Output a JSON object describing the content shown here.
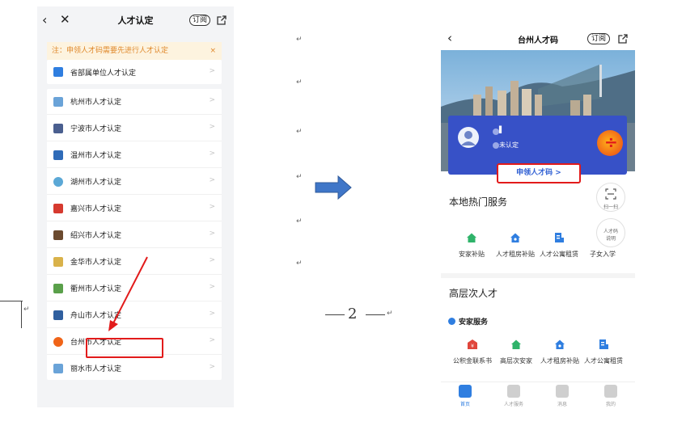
{
  "left_phone": {
    "title": "人才认定",
    "back_glyph": "‹",
    "close_glyph": "✕",
    "subscribe": "订阅",
    "notice": "注：申领人才码需要先进行人才认定",
    "notice_close": "×",
    "items": [
      {
        "label": "省部属单位人才认定"
      },
      {
        "label": "杭州市人才认定"
      },
      {
        "label": "宁波市人才认定"
      },
      {
        "label": "温州市人才认定"
      },
      {
        "label": "湖州市人才认定"
      },
      {
        "label": "嘉兴市人才认定"
      },
      {
        "label": "绍兴市人才认定"
      },
      {
        "label": "金华市人才认定"
      },
      {
        "label": "衢州市人才认定"
      },
      {
        "label": "舟山市人才认定"
      },
      {
        "label": "台州市人才认定"
      },
      {
        "label": "丽水市人才认定"
      }
    ],
    "chevron": ">"
  },
  "document": {
    "return_mark": "↵",
    "page_number": "2"
  },
  "right_phone": {
    "title": "台州人才码",
    "back_glyph": "‹",
    "subscribe": "订阅",
    "profile": {
      "name_masked": "▌",
      "status": "未认定"
    },
    "apply_button": "申领人才码  >",
    "local_services_title": "本地热门服务",
    "local_services": [
      {
        "label": "安家补贴",
        "icon": "house-icon",
        "color": "#2fb36a"
      },
      {
        "label": "人才租房补贴",
        "icon": "house-icon",
        "color": "#2f7ee0"
      },
      {
        "label": "人才公寓租赁",
        "icon": "apartment-icon",
        "color": "#2f7ee0"
      },
      {
        "label": "子女入学",
        "icon": "student-icon",
        "color": "#2f7ee0"
      }
    ],
    "float_scan": "扫一扫",
    "float_code_line1": "人才码",
    "float_code_line2": "说明",
    "high_level_title": "高层次人才",
    "settle_title": "安家服务",
    "settle_services": [
      {
        "label": "公积金联系书",
        "icon": "fund-icon",
        "color": "#e0463c"
      },
      {
        "label": "高层次安家",
        "icon": "house-icon",
        "color": "#2fb36a"
      },
      {
        "label": "人才租房补贴",
        "icon": "house-icon",
        "color": "#2f7ee0"
      },
      {
        "label": "人才公寓租赁",
        "icon": "apartment-icon",
        "color": "#2f7ee0"
      }
    ],
    "tabs": [
      {
        "label": "首页",
        "icon": "home-icon"
      },
      {
        "label": "人才服务",
        "icon": "user-icon"
      },
      {
        "label": "消息",
        "icon": "message-icon"
      },
      {
        "label": "我的",
        "icon": "profile-icon"
      }
    ],
    "active_tab": "首页"
  },
  "colors": {
    "highlight_red": "#e21b1b",
    "arrow_blue": "#3f76c8",
    "profile_blue": "#3751c7",
    "notice_bg": "#fdf3df",
    "notice_text": "#e0892c"
  }
}
